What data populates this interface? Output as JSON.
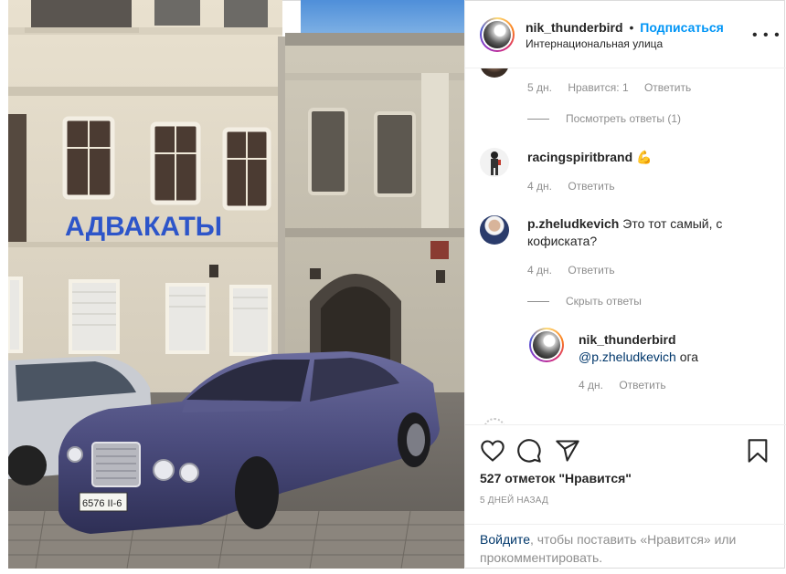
{
  "post": {
    "author": "nik_thunderbird",
    "separator": "•",
    "follow_label": "Подписаться",
    "location": "Интернациональная улица",
    "more_icon": "more-horizontal-icon",
    "photo_sign_text": "АДВАКАТЫ",
    "plate_text": "6576 II-6"
  },
  "comments": {
    "top_partial": {
      "time": "5 дн.",
      "likes": "Нравится: 1",
      "reply": "Ответить",
      "view_replies": "Посмотреть ответы (1)"
    },
    "c1": {
      "user": "racingspiritbrand",
      "emoji": "💪",
      "time": "4 дн.",
      "reply": "Ответить"
    },
    "c2": {
      "user": "p.zheludkevich",
      "text": "Это тот самый, с кофиската?",
      "time": "4 дн.",
      "reply": "Ответить",
      "hide_replies": "Скрыть ответы"
    },
    "reply1": {
      "user": "nik_thunderbird",
      "mention": "@p.zheludkevich",
      "text": "ога",
      "time": "4 дн.",
      "reply": "Ответить"
    }
  },
  "actions": {
    "like_icon": "heart-icon",
    "comment_icon": "comment-icon",
    "share_icon": "share-icon",
    "save_icon": "bookmark-icon",
    "likes_text": "527 отметок \"Нравится\"",
    "date_text": "5 ДНЕЙ НАЗАД",
    "login_link": "Войдите",
    "login_rest": ", чтобы поставить «Нравится» или прокомментировать."
  },
  "colors": {
    "link_blue": "#0095f6",
    "dark_link": "#00376b",
    "muted": "#8e8e8e",
    "car_purple": "#4b4c7d"
  }
}
